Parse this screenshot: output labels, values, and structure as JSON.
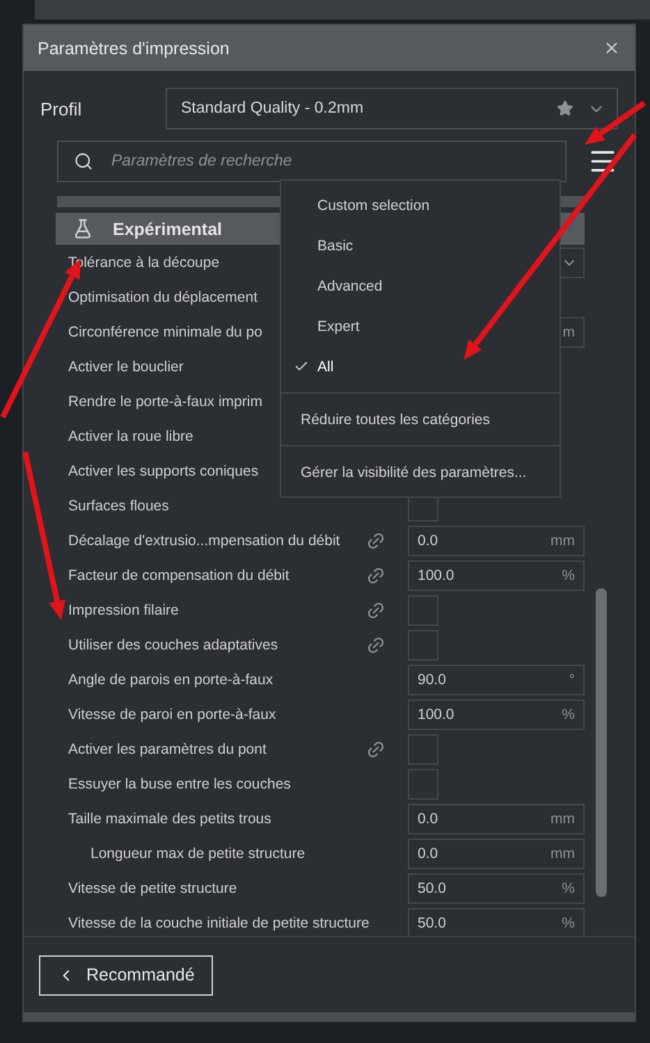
{
  "window": {
    "title": "Paramètres d'impression"
  },
  "profile": {
    "label": "Profil",
    "value": "Standard Quality - 0.2mm"
  },
  "search": {
    "placeholder": "Paramètres de recherche"
  },
  "category": {
    "label": "Expérimental",
    "expanded": true
  },
  "settings": [
    {
      "label": "Tolérance à la découpe",
      "kind": "select",
      "linked": false
    },
    {
      "label": "Optimisation du déplacement",
      "kind": "text",
      "linked": false
    },
    {
      "label": "Circonférence minimale du po",
      "kind": "field",
      "linked": false,
      "unit": "m"
    },
    {
      "label": "Activer le bouclier",
      "kind": "text",
      "linked": false
    },
    {
      "label": "Rendre le porte-à-faux imprim",
      "kind": "text",
      "linked": false
    },
    {
      "label": "Activer la roue libre",
      "kind": "text",
      "linked": false
    },
    {
      "label": "Activer les supports coniques",
      "kind": "text",
      "linked": false
    },
    {
      "label": "Surfaces floues",
      "kind": "checkbox",
      "linked": false,
      "checked": false
    },
    {
      "label": "Décalage d'extrusio...mpensation du débit",
      "kind": "field",
      "linked": true,
      "value": "0.0",
      "unit": "mm"
    },
    {
      "label": "Facteur de compensation du débit",
      "kind": "field",
      "linked": true,
      "value": "100.0",
      "unit": "%"
    },
    {
      "label": "Impression filaire",
      "kind": "checkbox",
      "linked": true,
      "checked": false
    },
    {
      "label": "Utiliser des couches adaptatives",
      "kind": "checkbox",
      "linked": true,
      "checked": false
    },
    {
      "label": "Angle de parois en porte-à-faux",
      "kind": "field",
      "linked": false,
      "value": "90.0",
      "unit": "°"
    },
    {
      "label": "Vitesse de paroi en porte-à-faux",
      "kind": "field",
      "linked": false,
      "value": "100.0",
      "unit": "%"
    },
    {
      "label": "Activer les paramètres du pont",
      "kind": "checkbox",
      "linked": true,
      "checked": false
    },
    {
      "label": "Essuyer la buse entre les couches",
      "kind": "checkbox",
      "linked": false,
      "checked": false
    },
    {
      "label": "Taille maximale des petits trous",
      "kind": "field",
      "linked": false,
      "value": "0.0",
      "unit": "mm",
      "children": [
        {
          "label": "Longueur max de petite structure",
          "kind": "field",
          "linked": false,
          "value": "0.0",
          "unit": "mm"
        }
      ]
    },
    {
      "label": "Vitesse de petite structure",
      "kind": "field",
      "linked": false,
      "value": "50.0",
      "unit": "%"
    },
    {
      "label": "Vitesse de la couche initiale de petite structure",
      "kind": "field",
      "linked": false,
      "value": "50.0",
      "unit": "%"
    }
  ],
  "menu": [
    {
      "label": "Custom selection",
      "kind": "option",
      "selected": false
    },
    {
      "label": "Basic",
      "kind": "option",
      "selected": false
    },
    {
      "label": "Advanced",
      "kind": "option",
      "selected": false
    },
    {
      "label": "Expert",
      "kind": "option",
      "selected": false
    },
    {
      "label": "All",
      "kind": "option",
      "selected": true
    },
    {
      "label": "Réduire toutes les catégories",
      "kind": "action"
    },
    {
      "label": "Gérer la visibilité des paramètres...",
      "kind": "action"
    }
  ],
  "footer": {
    "button": "Recommandé"
  }
}
